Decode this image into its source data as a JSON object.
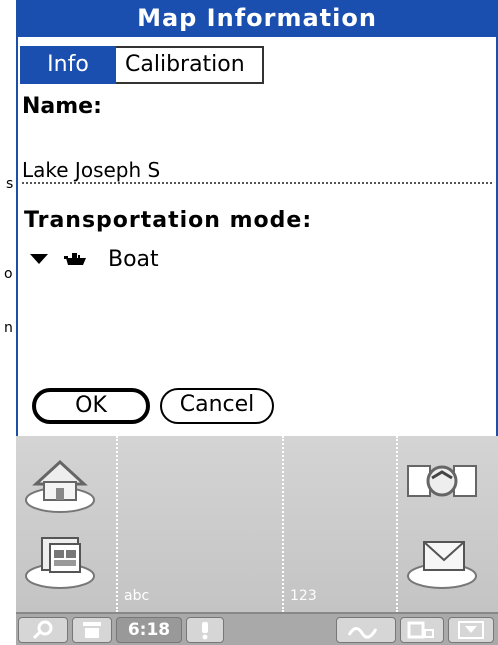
{
  "dialog": {
    "title": "Map Information"
  },
  "tabs": [
    {
      "label": "Info",
      "active": true
    },
    {
      "label": "Calibration",
      "active": false
    }
  ],
  "name": {
    "label": "Name:",
    "value": "Lake Joseph S"
  },
  "transportation": {
    "label": "Transportation mode:",
    "value": "Boat",
    "icon": "boat-icon"
  },
  "buttons": {
    "ok": "OK",
    "cancel": "Cancel"
  },
  "background_fragments": {
    "a": "s",
    "b": "o",
    "c": "n"
  },
  "graffiti": {
    "abc_label": "abc",
    "num_label": "123",
    "icons": [
      "home-icon",
      "applications-icon",
      "sync-icon",
      "mail-icon"
    ]
  },
  "statusbar": {
    "time": "6:18",
    "icons": [
      "find-icon",
      "menu-icon",
      "alert-icon",
      "graffiti-icon",
      "input-mode-icon",
      "dismiss-keyboard-icon"
    ]
  },
  "colors": {
    "title_bar": "#1a4fb0",
    "graffiti_bg": "#cccccc"
  }
}
